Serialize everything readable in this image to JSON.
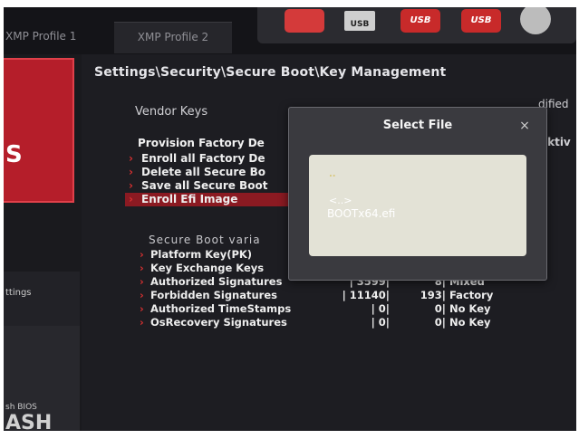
{
  "tabs": [
    "XMP Profile 1",
    "XMP Profile 2"
  ],
  "boot_devices": [
    {
      "icon": "red-drive-icon",
      "label": ""
    },
    {
      "icon": "usb-drive-icon",
      "label": "USB"
    },
    {
      "icon": "usb-icon",
      "label": "USB"
    },
    {
      "icon": "usb-icon",
      "label": "USB"
    },
    {
      "icon": "optical-disc-icon",
      "label": ""
    }
  ],
  "left_panel": {
    "settings_letter": "S",
    "settings_label": "ttings",
    "flash_small": "sh BIOS",
    "flash_big": "ASH"
  },
  "breadcrumb": "Settings\\Security\\Secure Boot\\Key Management",
  "vendor_keys_label": "Vendor Keys",
  "modified_fragment": "dified",
  "aktiv_fragment": "aktiv",
  "provision_label": "Provision Factory De",
  "menu_items": [
    {
      "label": "Enroll all Factory De"
    },
    {
      "label": "Delete all Secure Bo"
    },
    {
      "label": "Save all Secure Boot"
    },
    {
      "label": "Enroll Efi Image"
    }
  ],
  "secure_boot_title": "Secure Boot varia",
  "key_rows": [
    {
      "name": "Platform Key(PK)",
      "v1": "",
      "v2": "",
      "v3": ""
    },
    {
      "name": "Key Exchange Keys",
      "v1": "",
      "v2": "",
      "v3": ""
    },
    {
      "name": "Authorized Signatures",
      "v1": "| 3599|",
      "v2": "8|",
      "v3": "Mixed"
    },
    {
      "name": "Forbidden  Signatures",
      "v1": "| 11140|",
      "v2": "193|",
      "v3": "Factory"
    },
    {
      "name": "Authorized TimeStamps",
      "v1": "| 0|",
      "v2": "0|",
      "v3": "No Key"
    },
    {
      "name": "OsRecovery Signatures",
      "v1": "| 0|",
      "v2": "0|",
      "v3": "No Key"
    }
  ],
  "dialog": {
    "title": "Select File",
    "close": "×",
    "files": [
      "..",
      "<..>",
      "BOOTx64.efi"
    ]
  },
  "colors": {
    "accent_red": "#b51e2a",
    "selected_row": "#8b1a22",
    "dialog_bg": "#3a3a3f",
    "file_pane": "#e3e2d6"
  }
}
